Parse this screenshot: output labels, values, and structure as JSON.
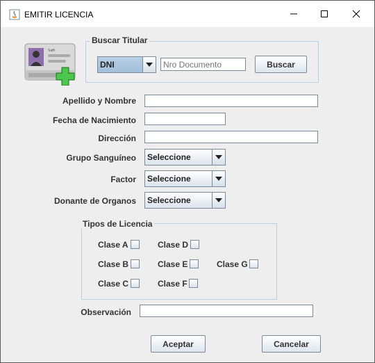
{
  "window": {
    "title": "EMITIR LICENCIA"
  },
  "search": {
    "legend": "Buscar Titular",
    "doc_type": "DNI",
    "doc_number_placeholder": "Nro Documento",
    "search_button": "Buscar"
  },
  "card_icon_text": "Saffi",
  "form": {
    "apellido_label": "Apellido y Nombre",
    "fecha_label": "Fecha de Nacimiento",
    "direccion_label": "Dirección",
    "grupo_label": "Grupo Sanguíneo",
    "grupo_value": "Seleccione",
    "factor_label": "Factor",
    "factor_value": "Seleccione",
    "donante_label": "Donante de Organos",
    "donante_value": "Seleccione"
  },
  "licencias": {
    "legend": "Tipos de Licencia",
    "clase_a": "Clase A",
    "clase_b": "Clase B",
    "clase_c": "Clase C",
    "clase_d": "Clase D",
    "clase_e": "Clase E",
    "clase_f": "Clase F",
    "clase_g": "Clase G"
  },
  "observacion_label": "Observación",
  "buttons": {
    "accept": "Aceptar",
    "cancel": "Cancelar"
  }
}
